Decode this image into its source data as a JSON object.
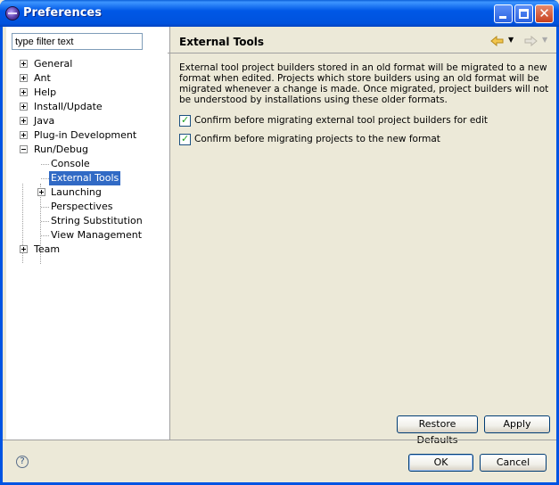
{
  "window": {
    "title": "Preferences"
  },
  "filter": {
    "placeholder": "type filter text"
  },
  "tree": [
    {
      "label": "General",
      "expander": "plus"
    },
    {
      "label": "Ant",
      "expander": "plus"
    },
    {
      "label": "Help",
      "expander": "plus"
    },
    {
      "label": "Install/Update",
      "expander": "plus"
    },
    {
      "label": "Java",
      "expander": "plus"
    },
    {
      "label": "Plug-in Development",
      "expander": "plus"
    },
    {
      "label": "Run/Debug",
      "expander": "minus"
    },
    {
      "label": "Console",
      "expander": "none"
    },
    {
      "label": "External Tools",
      "expander": "none",
      "selected": true
    },
    {
      "label": "Launching",
      "expander": "plus"
    },
    {
      "label": "Perspectives",
      "expander": "none"
    },
    {
      "label": "String Substitution",
      "expander": "none"
    },
    {
      "label": "View Management",
      "expander": "none"
    },
    {
      "label": "Team",
      "expander": "plus"
    }
  ],
  "page": {
    "title": "External Tools",
    "description": "External tool project builders stored in an old format will be migrated to a new format when edited. Projects which store builders using an old format will be migrated whenever a change is made. Once migrated, project builders will not be understood by installations using these older formats.",
    "checkboxes": [
      {
        "label": "Confirm before migrating external tool project builders for edit",
        "checked": true
      },
      {
        "label": "Confirm before migrating projects to the new format",
        "checked": true
      }
    ],
    "restore_defaults": "Restore Defaults",
    "apply": "Apply"
  },
  "footer": {
    "ok": "OK",
    "cancel": "Cancel",
    "help_symbol": "?"
  }
}
